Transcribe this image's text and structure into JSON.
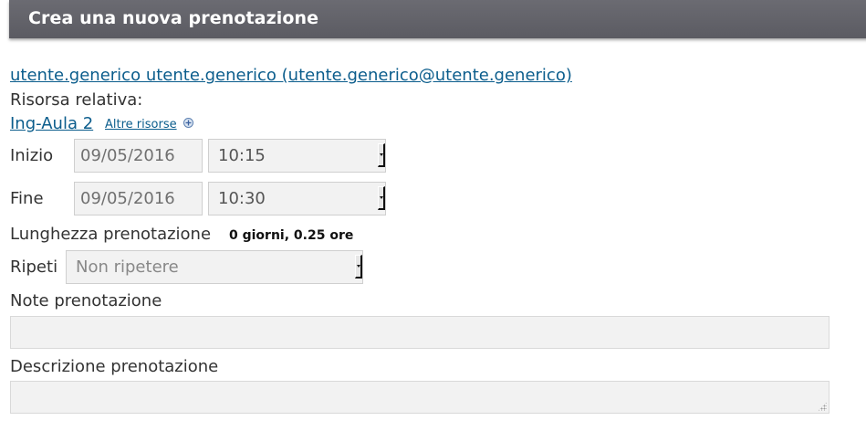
{
  "header": {
    "title": "Crea una nuova prenotazione"
  },
  "user": {
    "link_text": "utente.generico utente.generico (utente.generico@utente.generico)"
  },
  "resource": {
    "label": "Risorsa relativa:",
    "name": "Ing-Aula 2",
    "other_resources_link": "Altre risorse",
    "add_icon": "plus-circle-icon"
  },
  "start": {
    "label": "Inizio",
    "date_value": "09/05/2016",
    "time_value": "10:15"
  },
  "end": {
    "label": "Fine",
    "date_value": "09/05/2016",
    "time_value": "10:30"
  },
  "duration": {
    "label": "Lunghezza prenotazione",
    "value": "0 giorni, 0.25 ore"
  },
  "repeat": {
    "label": "Ripeti",
    "selected": "Non ripetere"
  },
  "notes": {
    "label": "Note prenotazione",
    "value": ""
  },
  "description": {
    "label": "Descrizione prenotazione",
    "value": ""
  },
  "colors": {
    "header_bg": "#5f5f66",
    "link": "#0b5d8c",
    "field_bg": "#f2f2f2"
  }
}
